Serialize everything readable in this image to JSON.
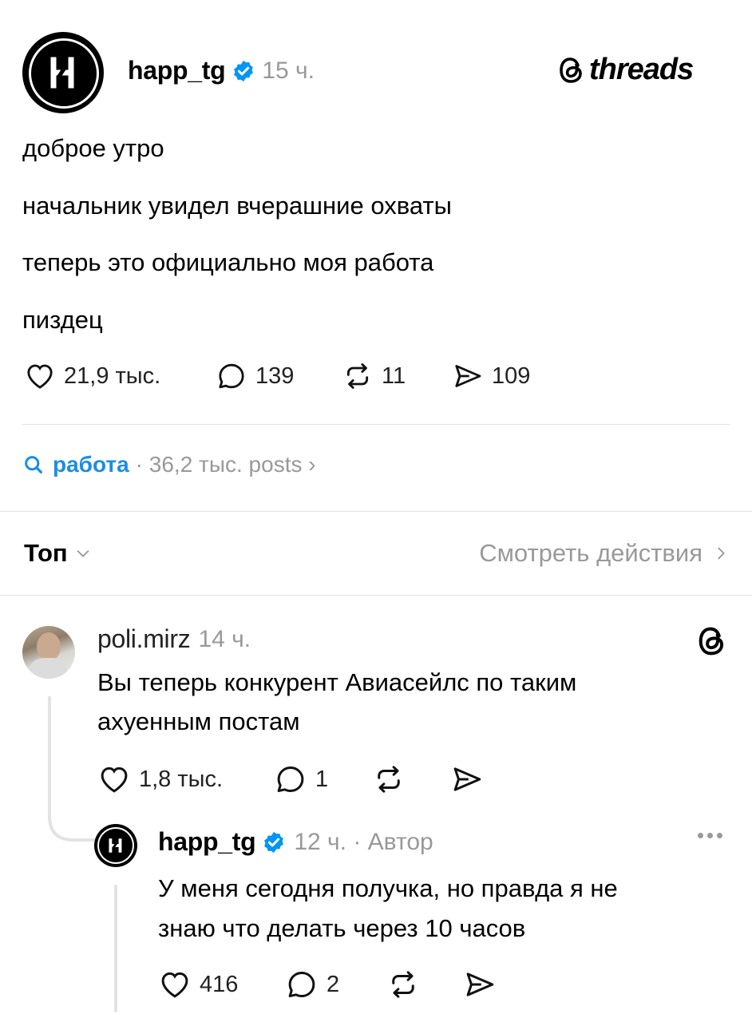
{
  "post": {
    "username": "happ_tg",
    "time": "15 ч.",
    "brand": "threads",
    "lines": [
      "доброе утро",
      "начальник увидел вчерашние охваты",
      "теперь это официально моя работа",
      "пиздец"
    ],
    "likes": "21,9 тыс.",
    "comments": "139",
    "reposts": "11",
    "shares": "109"
  },
  "topic": {
    "name": "работа",
    "meta": "· 36,2 тыс. posts ›"
  },
  "sort": {
    "label": "Топ",
    "view_actions": "Смотреть действия"
  },
  "replies": [
    {
      "username": "poli.mirz",
      "time": "14 ч.",
      "text_lines": [
        "Вы теперь конкурент Авиасейлс по таким",
        "ахуенным постам"
      ],
      "likes": "1,8 тыс.",
      "comments": "1"
    },
    {
      "username": "happ_tg",
      "time": "12 ч. · Автор",
      "text_lines": [
        "У меня сегодня получка, но правда я не",
        "знаю что делать через 10 часов"
      ],
      "likes": "416",
      "comments": "2"
    }
  ],
  "colors": {
    "accent": "#1a8fe3",
    "verified": "#0095f6",
    "muted": "#999999",
    "divider": "#e3e3e3"
  },
  "icons": [
    "heart-icon",
    "comment-icon",
    "repost-icon",
    "share-icon",
    "search-icon",
    "verified-icon",
    "threads-icon",
    "more-icon",
    "chevron-down-icon",
    "chevron-right-icon"
  ]
}
